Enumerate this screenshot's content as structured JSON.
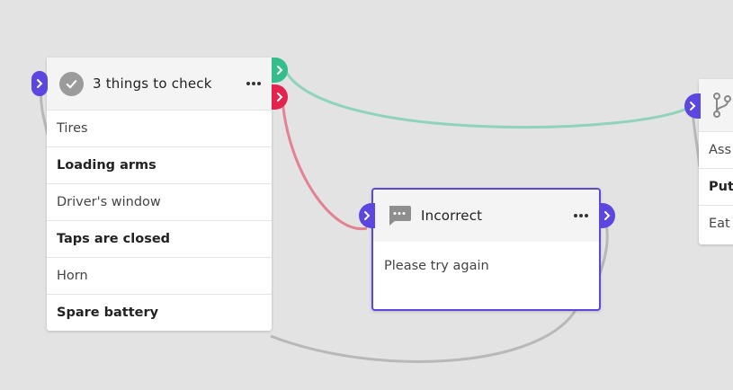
{
  "nodes": {
    "checklist": {
      "title": "3 things to check",
      "icon": "check-circle-icon",
      "items": [
        {
          "label": "Tires",
          "bold": false
        },
        {
          "label": "Loading arms",
          "bold": true
        },
        {
          "label": "Driver's window",
          "bold": false
        },
        {
          "label": "Taps are closed",
          "bold": true
        },
        {
          "label": "Horn",
          "bold": false
        },
        {
          "label": "Spare battery",
          "bold": true
        }
      ]
    },
    "message": {
      "title": "Incorrect",
      "icon": "chat-bubble-icon",
      "body": "Please try again"
    },
    "branch": {
      "icon": "branch-icon",
      "items": [
        "Ass",
        "Put",
        "Eat"
      ]
    }
  },
  "colors": {
    "canvas": "#e3e3e3",
    "port_input": "#5b46e0",
    "port_success": "#35be8c",
    "port_fail": "#e2234d",
    "edge_success": "#8fd3bb",
    "edge_fail": "#e38293",
    "edge_default": "#b8b8b8",
    "selected_border": "#5b46e0"
  }
}
